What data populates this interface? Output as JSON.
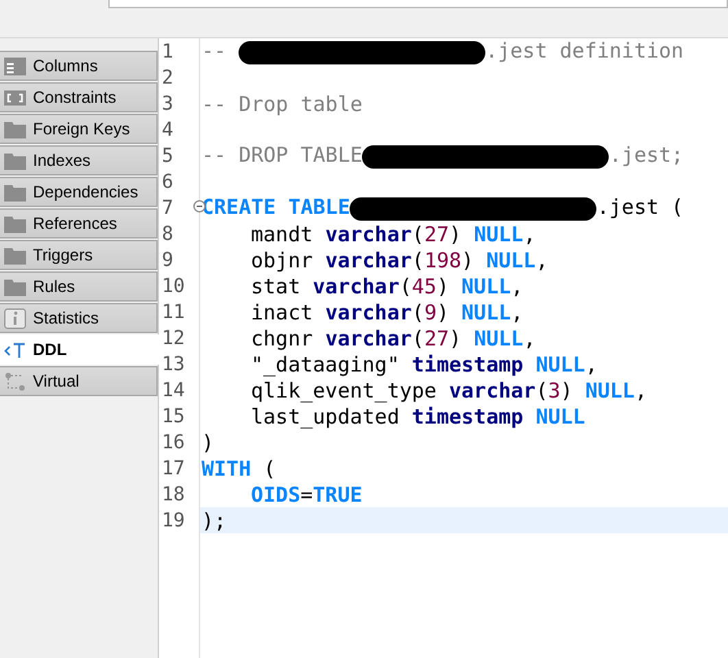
{
  "sidebar": {
    "items": [
      {
        "label": "Columns",
        "kind": "columns",
        "selected": false
      },
      {
        "label": "Constraints",
        "kind": "constraints",
        "selected": false
      },
      {
        "label": "Foreign Keys",
        "kind": "folder",
        "selected": false
      },
      {
        "label": "Indexes",
        "kind": "folder",
        "selected": false
      },
      {
        "label": "Dependencies",
        "kind": "folder",
        "selected": false
      },
      {
        "label": "References",
        "kind": "folder",
        "selected": false
      },
      {
        "label": "Triggers",
        "kind": "folder",
        "selected": false
      },
      {
        "label": "Rules",
        "kind": "folder",
        "selected": false
      },
      {
        "label": "Statistics",
        "kind": "info",
        "selected": false
      },
      {
        "label": "DDL",
        "kind": "ddl",
        "selected": true
      },
      {
        "label": "Virtual",
        "kind": "virtual",
        "selected": false
      }
    ]
  },
  "editor": {
    "lines": [
      {
        "number": "1",
        "foldable": false,
        "current": false,
        "tokens": [
          {
            "kind": "comment",
            "text": "-- "
          },
          {
            "kind": "redacted"
          },
          {
            "kind": "comment",
            "text": ".jest definition"
          }
        ]
      },
      {
        "number": "2",
        "foldable": false,
        "current": false
      },
      {
        "number": "3",
        "foldable": false,
        "current": false,
        "tokens": [
          {
            "kind": "comment",
            "text": "-- Drop table"
          }
        ]
      },
      {
        "number": "4",
        "foldable": false,
        "current": false
      },
      {
        "number": "5",
        "foldable": false,
        "current": false,
        "tokens": [
          {
            "kind": "comment",
            "text": "-- DROP TABLE"
          },
          {
            "kind": "redacted"
          },
          {
            "kind": "comment",
            "text": ".jest;"
          }
        ]
      },
      {
        "number": "6",
        "foldable": false,
        "current": false
      },
      {
        "number": "7",
        "foldable": true,
        "current": false,
        "tokens": [
          {
            "kind": "keyword",
            "text": "CREATE TABLE"
          },
          {
            "kind": "redacted"
          },
          {
            "kind": "plain",
            "text": ".jest ("
          }
        ]
      },
      {
        "number": "8",
        "foldable": false,
        "current": false,
        "tokens": [
          {
            "kind": "indent"
          },
          {
            "kind": "plain",
            "text": "mandt "
          },
          {
            "kind": "type",
            "text": "varchar"
          },
          {
            "kind": "plain",
            "text": "("
          },
          {
            "kind": "number",
            "text": "27"
          },
          {
            "kind": "plain",
            "text": ") "
          },
          {
            "kind": "keyword",
            "text": "NULL"
          },
          {
            "kind": "plain",
            "text": ","
          }
        ]
      },
      {
        "number": "9",
        "foldable": false,
        "current": false,
        "tokens": [
          {
            "kind": "indent"
          },
          {
            "kind": "plain",
            "text": "objnr "
          },
          {
            "kind": "type",
            "text": "varchar"
          },
          {
            "kind": "plain",
            "text": "("
          },
          {
            "kind": "number",
            "text": "198"
          },
          {
            "kind": "plain",
            "text": ") "
          },
          {
            "kind": "keyword",
            "text": "NULL"
          },
          {
            "kind": "plain",
            "text": ","
          }
        ]
      },
      {
        "number": "10",
        "foldable": false,
        "current": false,
        "tokens": [
          {
            "kind": "indent"
          },
          {
            "kind": "plain",
            "text": "stat "
          },
          {
            "kind": "type",
            "text": "varchar"
          },
          {
            "kind": "plain",
            "text": "("
          },
          {
            "kind": "number",
            "text": "45"
          },
          {
            "kind": "plain",
            "text": ") "
          },
          {
            "kind": "keyword",
            "text": "NULL"
          },
          {
            "kind": "plain",
            "text": ","
          }
        ]
      },
      {
        "number": "11",
        "foldable": false,
        "current": false,
        "tokens": [
          {
            "kind": "indent"
          },
          {
            "kind": "plain",
            "text": "inact "
          },
          {
            "kind": "type",
            "text": "varchar"
          },
          {
            "kind": "plain",
            "text": "("
          },
          {
            "kind": "number",
            "text": "9"
          },
          {
            "kind": "plain",
            "text": ") "
          },
          {
            "kind": "keyword",
            "text": "NULL"
          },
          {
            "kind": "plain",
            "text": ","
          }
        ]
      },
      {
        "number": "12",
        "foldable": false,
        "current": false,
        "tokens": [
          {
            "kind": "indent"
          },
          {
            "kind": "plain",
            "text": "chgnr "
          },
          {
            "kind": "type",
            "text": "varchar"
          },
          {
            "kind": "plain",
            "text": "("
          },
          {
            "kind": "number",
            "text": "27"
          },
          {
            "kind": "plain",
            "text": ") "
          },
          {
            "kind": "keyword",
            "text": "NULL"
          },
          {
            "kind": "plain",
            "text": ","
          }
        ]
      },
      {
        "number": "13",
        "foldable": false,
        "current": false,
        "tokens": [
          {
            "kind": "indent"
          },
          {
            "kind": "plain",
            "text": "\"_dataaging\" "
          },
          {
            "kind": "type",
            "text": "timestamp "
          },
          {
            "kind": "keyword",
            "text": "NULL"
          },
          {
            "kind": "plain",
            "text": ","
          }
        ]
      },
      {
        "number": "14",
        "foldable": false,
        "current": false,
        "tokens": [
          {
            "kind": "indent"
          },
          {
            "kind": "plain",
            "text": "qlik_event_type "
          },
          {
            "kind": "type",
            "text": "varchar"
          },
          {
            "kind": "plain",
            "text": "("
          },
          {
            "kind": "number",
            "text": "3"
          },
          {
            "kind": "plain",
            "text": ") "
          },
          {
            "kind": "keyword",
            "text": "NULL"
          },
          {
            "kind": "plain",
            "text": ","
          }
        ]
      },
      {
        "number": "15",
        "foldable": false,
        "current": false,
        "tokens": [
          {
            "kind": "indent"
          },
          {
            "kind": "plain",
            "text": "last_updated "
          },
          {
            "kind": "type",
            "text": "timestamp "
          },
          {
            "kind": "keyword",
            "text": "NULL"
          }
        ]
      },
      {
        "number": "16",
        "foldable": false,
        "current": false,
        "tokens": [
          {
            "kind": "plain",
            "text": ")"
          }
        ]
      },
      {
        "number": "17",
        "foldable": false,
        "current": false,
        "tokens": [
          {
            "kind": "keyword",
            "text": "WITH"
          },
          {
            "kind": "plain",
            "text": " ("
          }
        ]
      },
      {
        "number": "18",
        "foldable": false,
        "current": false,
        "tokens": [
          {
            "kind": "indent"
          },
          {
            "kind": "keyword",
            "text": "OIDS"
          },
          {
            "kind": "plain",
            "text": "="
          },
          {
            "kind": "keyword",
            "text": "TRUE"
          }
        ]
      },
      {
        "number": "19",
        "foldable": false,
        "current": true,
        "tokens": [
          {
            "kind": "plain",
            "text": ");"
          }
        ]
      }
    ]
  }
}
